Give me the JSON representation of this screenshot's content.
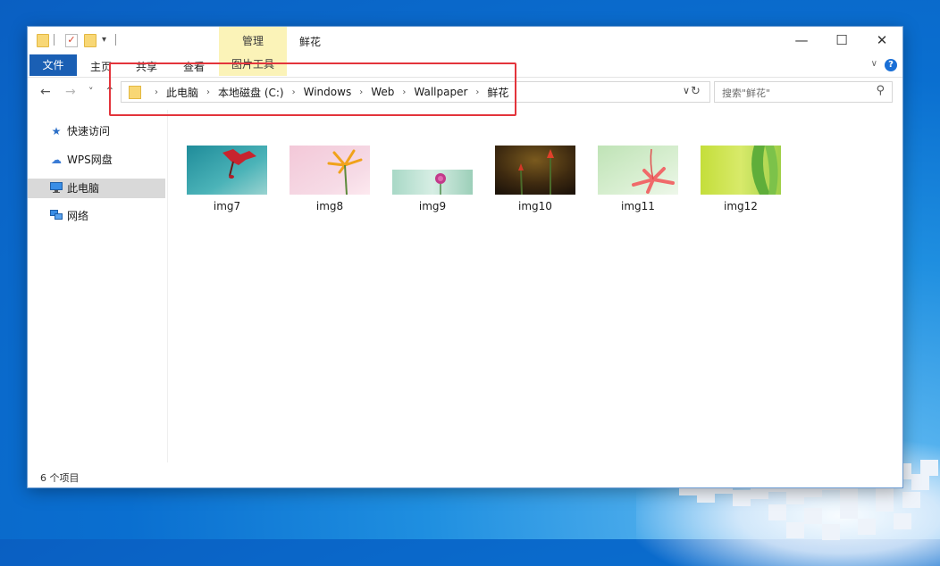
{
  "window": {
    "title": "鲜花",
    "manage_tab": "管理",
    "minimize": "—",
    "maximize": "☐",
    "close": "✕"
  },
  "ribbon": {
    "file": "文件",
    "tabs": [
      "主页",
      "共享",
      "查看"
    ],
    "picture_tools": "图片工具",
    "collapse": "∨",
    "help": "?"
  },
  "address": {
    "crumbs": [
      "此电脑",
      "本地磁盘 (C:)",
      "Windows",
      "Web",
      "Wallpaper",
      "鲜花"
    ],
    "separator": "›",
    "dropdown": "∨",
    "refresh": "↻"
  },
  "nav": {
    "back": "←",
    "forward": "→",
    "recent": "˅",
    "up": "↑"
  },
  "search": {
    "placeholder": "搜索\"鲜花\"",
    "icon": "⚲"
  },
  "sidebar": {
    "items": [
      {
        "label": "快速访问",
        "icon": "star-icon",
        "glyph": "★",
        "color": "#2b6fc7"
      },
      {
        "label": "WPS网盘",
        "icon": "cloud-icon",
        "glyph": "☁",
        "color": "#3a7bd5"
      },
      {
        "label": "此电脑",
        "icon": "computer-icon",
        "glyph": "🖥",
        "color": "#2b7bd0",
        "selected": true
      },
      {
        "label": "网络",
        "icon": "network-icon",
        "glyph": "⊞",
        "color": "#2b6fc7"
      }
    ]
  },
  "files": [
    {
      "name": "img7"
    },
    {
      "name": "img8"
    },
    {
      "name": "img9"
    },
    {
      "name": "img10"
    },
    {
      "name": "img11"
    },
    {
      "name": "img12"
    }
  ],
  "status": {
    "count": "6 个项目"
  },
  "colors": {
    "accent": "#1a5fb4",
    "highlight": "#e3343b",
    "picture_tools_bg": "#fbf3b8"
  }
}
